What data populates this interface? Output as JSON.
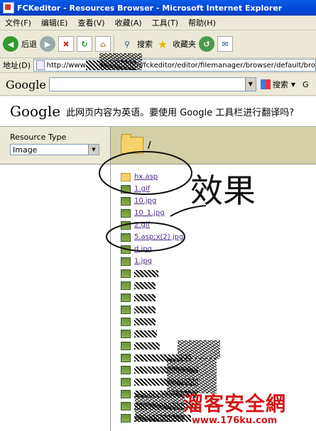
{
  "window": {
    "title": "FCKeditor - Resources Browser - Microsoft Internet Explorer"
  },
  "menu": [
    "文件(F)",
    "编辑(E)",
    "查看(V)",
    "收藏(A)",
    "工具(T)",
    "帮助(H)"
  ],
  "toolbar": {
    "back_label": "后退",
    "search_label": "搜索",
    "favorites_label": "收藏夹"
  },
  "address": {
    "label": "地址(D)",
    "url_start": "http://www",
    "url_end": "n/fckeditor/editor/filemanager/browser/default/bro"
  },
  "google_toolbar": {
    "logo": "Google",
    "search_label": "搜索",
    "extra": "G"
  },
  "translate_bar": {
    "logo": "Google",
    "message": "此网页内容为英语。要使用 Google 工具栏进行翻译吗?"
  },
  "resource_type": {
    "label": "Resource Type",
    "selected": "Image"
  },
  "path": {
    "current": "/"
  },
  "files": [
    {
      "name": "hx.asp",
      "kind": "folder"
    },
    {
      "name": "1.gif",
      "kind": "image"
    },
    {
      "name": "10.jpg",
      "kind": "image"
    },
    {
      "name": "10_1.jpg",
      "kind": "image"
    },
    {
      "name": "2.gif",
      "kind": "image"
    },
    {
      "name": "5.asp;x(2).jpg",
      "kind": "image"
    },
    {
      "name": "d.jpg",
      "kind": "image"
    },
    {
      "name": "1.jpg",
      "kind": "image"
    }
  ],
  "annotation": {
    "handwriting": "效果"
  },
  "watermark": {
    "line1": "溜客安全網",
    "line2": "www.176ku.com"
  },
  "colors": {
    "titlebar": "#0046d5",
    "link": "#4a2a8a",
    "pathbar": "#d3d0a8",
    "watermark": "#d31717"
  }
}
